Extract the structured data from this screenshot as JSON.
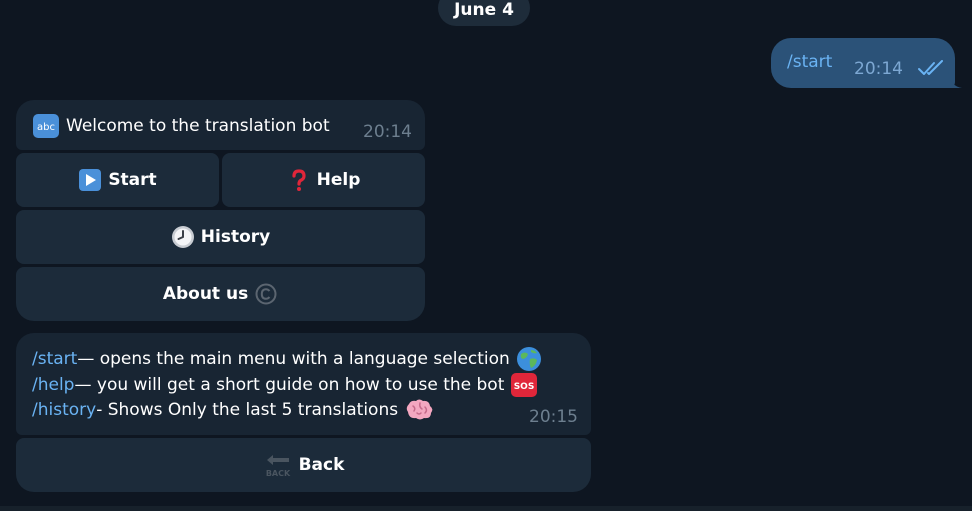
{
  "date_pill": "June 4",
  "outgoing": {
    "text": "/start",
    "time": "20:14"
  },
  "welcome": {
    "text": "Welcome to the translation bot",
    "time": "20:14",
    "icon": "abc-icon"
  },
  "keyboard": {
    "start_label": "Start",
    "help_label": "Help",
    "history_label": "History",
    "about_label": "About us"
  },
  "help_message": {
    "line1_cmd": "/start",
    "line1_text": " — opens the main menu with a language selection",
    "line2_cmd": "/help",
    "line2_text": " — you will get a short guide on how to use the bot",
    "line3_cmd": "/history",
    "line3_text": " - Shows Only the last 5 translations",
    "time": "20:15"
  },
  "back_button": {
    "label": "Back",
    "icon_text": "BACK"
  },
  "sos_text": "SOS",
  "colors": {
    "background": "#0e1621",
    "incoming_bubble": "#182533",
    "outgoing_bubble": "#2b5278",
    "link": "#6ab3f3",
    "button": "#1c2b3a"
  }
}
